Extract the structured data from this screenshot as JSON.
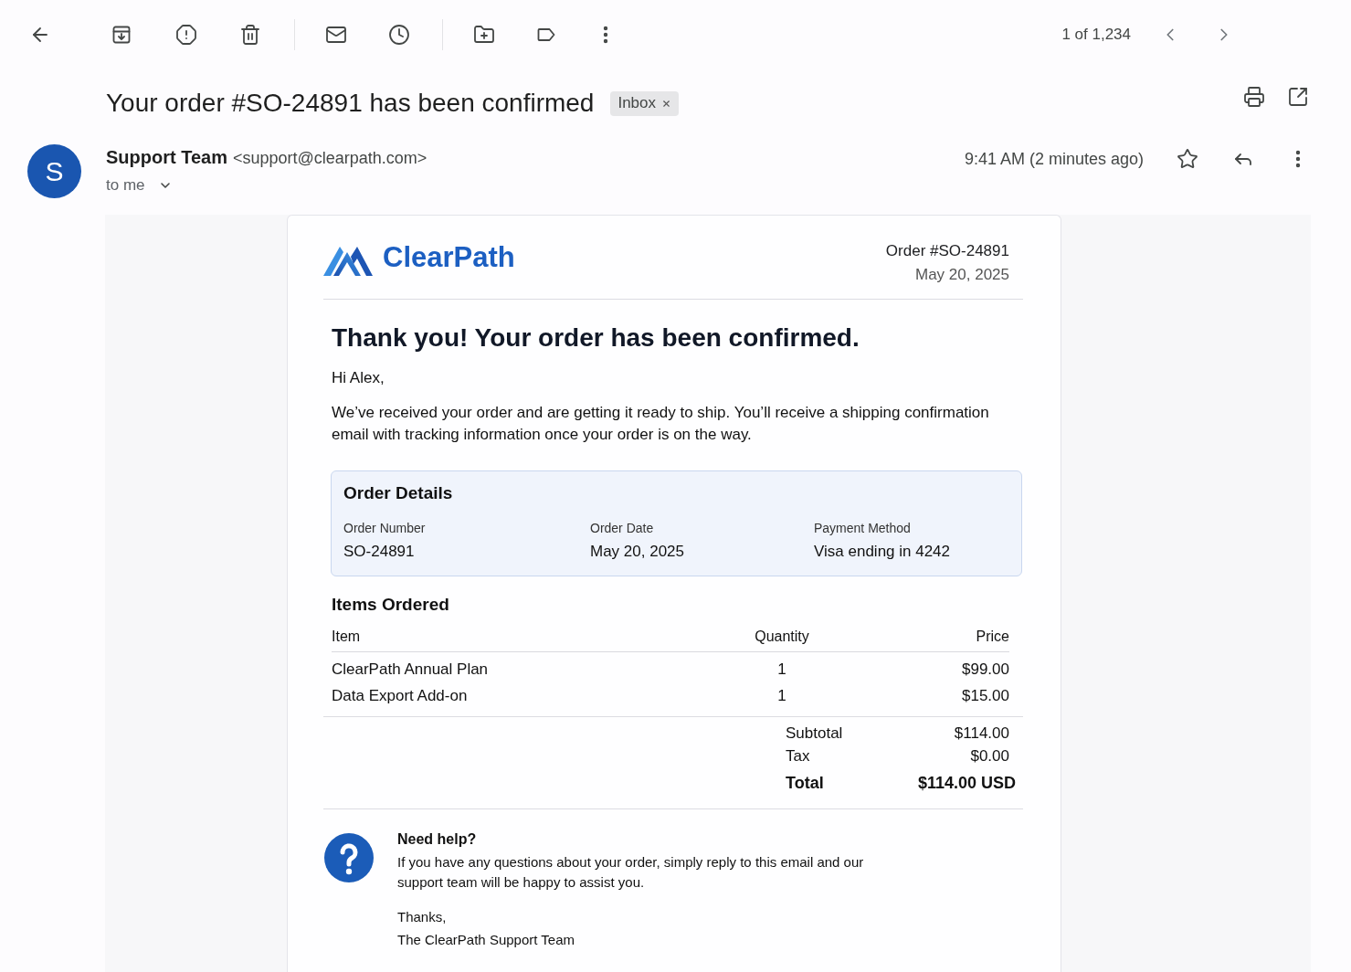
{
  "toolbar": {
    "counter": "1 of 1,234"
  },
  "message": {
    "subject": "Your order #SO-24891 has been confirmed",
    "labels": [
      {
        "name": "Inbox"
      }
    ]
  },
  "sender": {
    "initial": "S",
    "name": "Support Team",
    "email": "<support@clearpath.com>",
    "recipient": "to me",
    "time": "9:41 AM (2 minutes ago)",
    "starred": false
  },
  "email": {
    "brand": "ClearPath",
    "order_ref": "Order #SO-24891",
    "date": "May 20, 2025",
    "heading": "Thank you! Your order has been confirmed.",
    "greeting": "Hi Alex,",
    "intro": "We’ve received your order and are getting it ready to ship. You’ll receive a shipping confirmation email with tracking information once your order is on the way.",
    "details": {
      "title": "Order Details",
      "fields": [
        {
          "label": "Order Number",
          "value": "SO-24891"
        },
        {
          "label": "Order Date",
          "value": "May 20, 2025"
        },
        {
          "label": "Payment Method",
          "value": "Visa ending in 4242"
        }
      ]
    },
    "items": {
      "title": "Items Ordered",
      "columns": [
        "Item",
        "Quantity",
        "Price"
      ],
      "rows": [
        [
          "ClearPath Annual Plan",
          "1",
          "$99.00"
        ],
        [
          "Data Export Add-on",
          "1",
          "$15.00"
        ]
      ]
    },
    "totals": [
      {
        "kind": "line",
        "label": "Subtotal",
        "value": "$114.00"
      },
      {
        "kind": "line",
        "label": "Tax",
        "value": "$0.00"
      },
      {
        "kind": "total",
        "label": "Total",
        "value": "$114.00 USD"
      }
    ],
    "help": {
      "title": "Need help?",
      "text": "If you have any questions about your order, simply reply to this email and our support team will be happy to assist you."
    },
    "signoff": [
      "Thanks,",
      "The ClearPath Support Team"
    ]
  }
}
